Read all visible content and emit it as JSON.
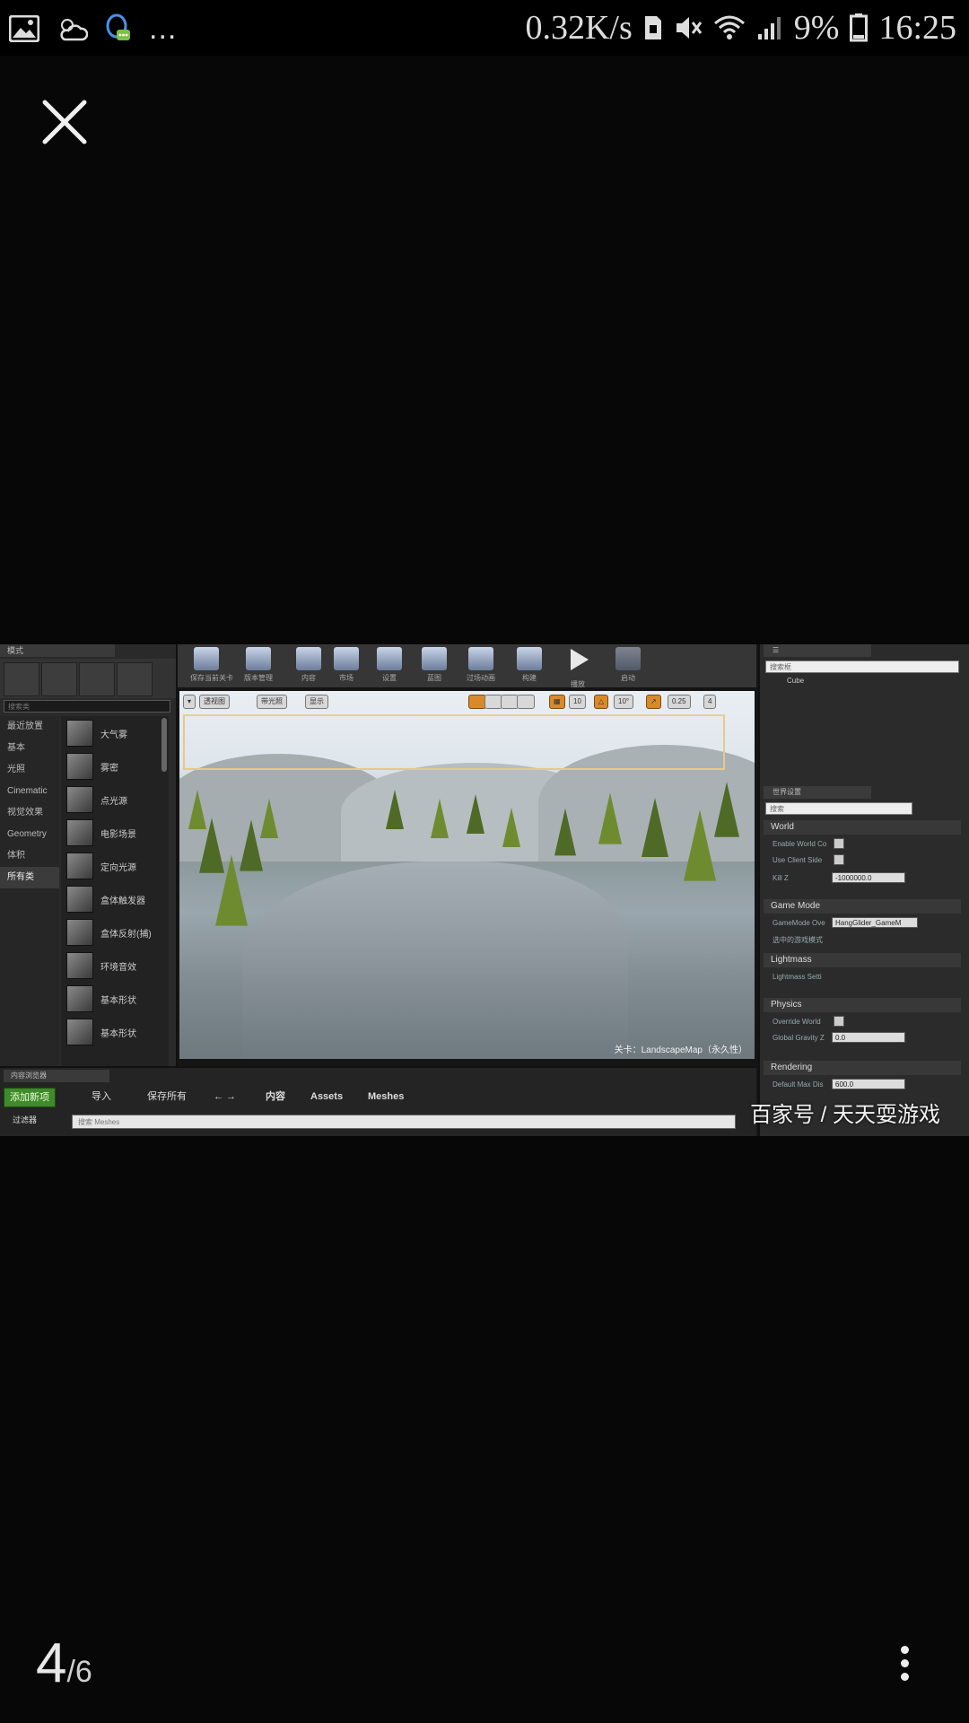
{
  "status_bar": {
    "more": "...",
    "network_speed": "0.32K/s",
    "battery_percent": "9%",
    "time": "16:25",
    "icons": [
      "gallery-icon",
      "weather-icon",
      "qq-icon",
      "sim-icon",
      "mute-icon",
      "wifi-icon",
      "signal-icon",
      "battery-icon"
    ]
  },
  "viewer": {
    "close_icon": "close-icon",
    "page_current": "4",
    "page_total": "/6",
    "more_icon": "more-vertical-icon",
    "watermark": "百家号 / 天天耍游戏"
  },
  "editor": {
    "left_tab": "模式",
    "search_placeholder": "搜索类",
    "categories": [
      "最近放置",
      "基本",
      "光照",
      "Cinematic",
      "视觉效果",
      "Geometry",
      "体积",
      "所有类"
    ],
    "items": [
      "大气雾",
      "雾密",
      "点光源",
      "电影场景",
      "定向光源",
      "盒体触发器",
      "盒体反射(捕)",
      "环境音效",
      "基本形状",
      "基本形状"
    ],
    "toolbar": [
      "保存当前关卡",
      "版本管理",
      "内容",
      "市场",
      "设置",
      "蓝图",
      "过场动画",
      "构建",
      "播放",
      "启动"
    ],
    "viewport_chips": [
      "透视图",
      "带光照",
      "显示"
    ],
    "viewport_numbers": [
      "10",
      "10°",
      "0.25",
      "4"
    ],
    "viewport_label": "关卡：LandscapeMap（永久性）",
    "outliner_search": "搜索框",
    "outliner_item": "Cube",
    "details_tab": "世界设置",
    "details_search": "搜索",
    "sections": [
      "World",
      "Game Mode",
      "Lightmass",
      "Physics",
      "Rendering"
    ],
    "world_rows": [
      "Enable World Co",
      "Use Client Side",
      "Kill Z"
    ],
    "kill_z_value": "-1000000.0",
    "gamemode_row": "GameMode Ove",
    "gamemode_value": "HangGlider_GameM",
    "gamemode_row2": "选中的游戏模式",
    "lightmass_row": "Lightmass Setti",
    "physics_rows": [
      "Override World",
      "Global Gravity Z"
    ],
    "physics_value": "0.0",
    "rendering_row": "Default Max Dis",
    "rendering_value": "600.0",
    "content_tab": "内容浏览器",
    "cb_add": "添加新项",
    "cb_import": "导入",
    "cb_save": "保存所有",
    "breadcrumb": [
      "内容",
      "Assets",
      "Meshes"
    ],
    "filter_label": "过滤器",
    "filter_placeholder": "搜索 Meshes"
  }
}
